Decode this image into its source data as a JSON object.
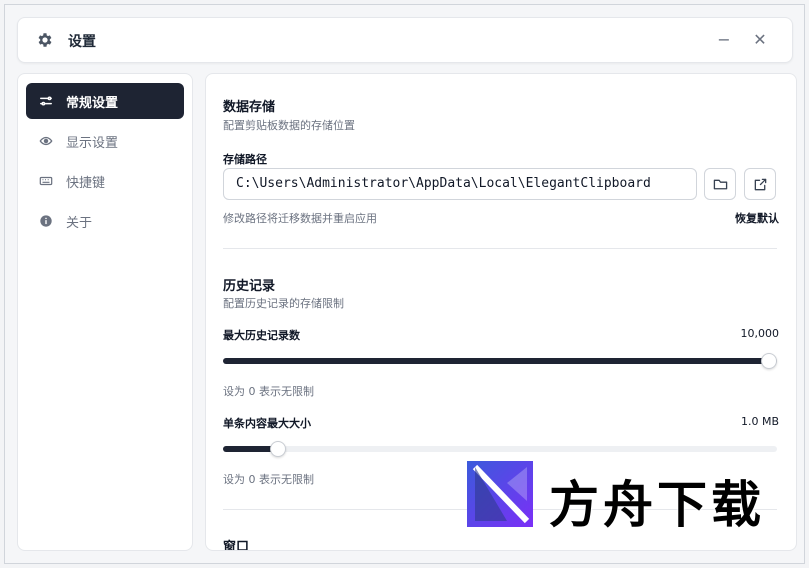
{
  "window": {
    "title": "设置",
    "minimize_label": "−",
    "close_label": "✕"
  },
  "sidebar": {
    "items": [
      {
        "label": "常规设置",
        "icon": "sliders-icon",
        "active": true
      },
      {
        "label": "显示设置",
        "icon": "eye-icon",
        "active": false
      },
      {
        "label": "快捷键",
        "icon": "keyboard-icon",
        "active": false
      },
      {
        "label": "关于",
        "icon": "info-icon",
        "active": false
      }
    ]
  },
  "storage": {
    "title": "数据存储",
    "desc": "配置剪贴板数据的存储位置",
    "path_label": "存储路径",
    "path_value": "C:\\Users\\Administrator\\AppData\\Local\\ElegantClipboard",
    "browse_icon": "folder-icon",
    "open_icon": "external-link-icon",
    "hint": "修改路径将迁移数据并重启应用",
    "reset_label": "恢复默认"
  },
  "history": {
    "title": "历史记录",
    "desc": "配置历史记录的存储限制",
    "max_records_label": "最大历史记录数",
    "max_records_value": "10,000",
    "max_records_fraction": 1.0,
    "max_records_hint": "设为 0 表示无限制",
    "max_size_label": "单条内容最大大小",
    "max_size_value": "1.0 MB",
    "max_size_fraction": 0.1,
    "max_size_hint": "设为 0 表示无限制"
  },
  "window_section": {
    "title": "窗口"
  },
  "watermark": {
    "text": "方舟下载"
  },
  "colors": {
    "accent": "#1e2433"
  }
}
